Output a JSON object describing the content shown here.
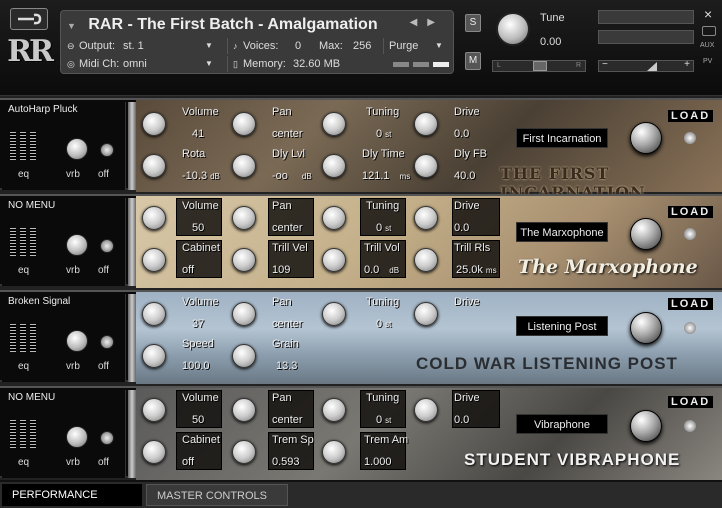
{
  "header": {
    "instrument_title": "RAR - The First Batch - Amalgamation",
    "output_label": "Output:",
    "output_value": "st. 1",
    "voices_label": "Voices:",
    "voices_value": "0",
    "max_label": "Max:",
    "max_value": "256",
    "purge_label": "Purge",
    "midi_label": "Midi Ch:",
    "midi_value": "omni",
    "memory_label": "Memory:",
    "memory_value": "32.60 MB",
    "solo_label": "S",
    "mute_label": "M",
    "tune_label": "Tune",
    "tune_value": "0.00",
    "pan_left": "L",
    "pan_right": "R",
    "aux_label": "AUX",
    "pv_label": "PV",
    "close_label": "×",
    "vol_minus": "−",
    "vol_plus": "+"
  },
  "slots": [
    {
      "menu": "AutoHarp Pluck",
      "eq": "eq",
      "vrb": "vrb",
      "off": "off",
      "params": [
        {
          "label": "Volume",
          "value": "41",
          "unit": ""
        },
        {
          "label": "Pan",
          "value": "center",
          "unit": ""
        },
        {
          "label": "Tuning",
          "value": "0",
          "unit": "st"
        },
        {
          "label": "Drive",
          "value": "0.0",
          "unit": ""
        },
        {
          "label": "Rota",
          "value": "-10.3",
          "unit": "dB"
        },
        {
          "label": "Dly Lvl",
          "value": "-oo",
          "unit": "dB"
        },
        {
          "label": "Dly Time",
          "value": "121.1",
          "unit": "ms"
        },
        {
          "label": "Dly FB",
          "value": "40.0",
          "unit": ""
        }
      ],
      "name": "First Incarnation",
      "load": "LOAD",
      "title": "THE FIRST INCARNATION"
    },
    {
      "menu": "NO MENU",
      "eq": "eq",
      "vrb": "vrb",
      "off": "off",
      "params": [
        {
          "label": "Volume",
          "value": "50",
          "unit": ""
        },
        {
          "label": "Pan",
          "value": "center",
          "unit": ""
        },
        {
          "label": "Tuning",
          "value": "0",
          "unit": "st"
        },
        {
          "label": "Drive",
          "value": "0.0",
          "unit": ""
        },
        {
          "label": "Cabinet",
          "value": "off",
          "unit": ""
        },
        {
          "label": "Trill Vel",
          "value": "109",
          "unit": ""
        },
        {
          "label": "Trill Vol",
          "value": "0.0",
          "unit": "dB"
        },
        {
          "label": "Trill Rls",
          "value": "25.0k",
          "unit": "ms"
        }
      ],
      "name": "The Marxophone",
      "load": "LOAD",
      "title": "The Marxophone"
    },
    {
      "menu": "Broken Signal",
      "eq": "eq",
      "vrb": "vrb",
      "off": "off",
      "params": [
        {
          "label": "Volume",
          "value": "37",
          "unit": ""
        },
        {
          "label": "Pan",
          "value": "center",
          "unit": ""
        },
        {
          "label": "Tuning",
          "value": "0",
          "unit": "st"
        },
        {
          "label": "Drive",
          "value": "",
          "unit": ""
        },
        {
          "label": "Speed",
          "value": "100.0",
          "unit": ""
        },
        {
          "label": "Grain",
          "value": "13.3",
          "unit": ""
        }
      ],
      "name": "Listening Post",
      "load": "LOAD",
      "title": "COLD WAR LISTENING POST"
    },
    {
      "menu": "NO MENU",
      "eq": "eq",
      "vrb": "vrb",
      "off": "off",
      "params": [
        {
          "label": "Volume",
          "value": "50",
          "unit": ""
        },
        {
          "label": "Pan",
          "value": "center",
          "unit": ""
        },
        {
          "label": "Tuning",
          "value": "0",
          "unit": "st"
        },
        {
          "label": "Drive",
          "value": "0.0",
          "unit": ""
        },
        {
          "label": "Cabinet",
          "value": "off",
          "unit": ""
        },
        {
          "label": "Trem Sp",
          "value": "0.593",
          "unit": ""
        },
        {
          "label": "Trem Am",
          "value": "1.000",
          "unit": ""
        }
      ],
      "name": "Vibraphone",
      "load": "LOAD",
      "title": "STUDENT VIBRAPHONE"
    }
  ],
  "tabs": [
    {
      "label": "PERFORMANCE"
    },
    {
      "label": "MASTER CONTROLS"
    }
  ]
}
